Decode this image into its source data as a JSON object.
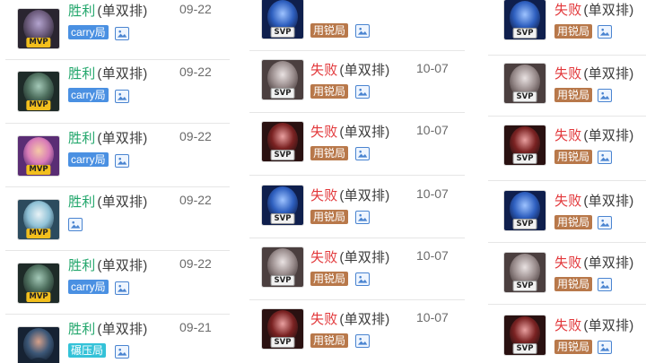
{
  "left_column": [
    {
      "result": "胜利",
      "queue": "(单双排)",
      "date": "09-22",
      "badge": "MVP",
      "tag": "carry局",
      "tag_style": "carry",
      "palette": [
        "#2a2530",
        "#6d5c7d",
        "#b3a4cf"
      ]
    },
    {
      "result": "胜利",
      "queue": "(单双排)",
      "date": "09-22",
      "badge": "MVP",
      "tag": "carry局",
      "tag_style": "carry",
      "palette": [
        "#1e2b28",
        "#4e6f5e",
        "#a4c9b8"
      ]
    },
    {
      "result": "胜利",
      "queue": "(单双排)",
      "date": "09-22",
      "badge": "MVP",
      "tag": "carry局",
      "tag_style": "carry",
      "palette": [
        "#5a2d74",
        "#d97cb8",
        "#f5c9a6"
      ]
    },
    {
      "result": "胜利",
      "queue": "(单双排)",
      "date": "09-22",
      "badge": "MVP",
      "tag": "",
      "tag_style": "",
      "palette": [
        "#2c4b5e",
        "#8fc1d6",
        "#e8f2f6"
      ]
    },
    {
      "result": "胜利",
      "queue": "(单双排)",
      "date": "09-22",
      "badge": "MVP",
      "tag": "carry局",
      "tag_style": "carry",
      "palette": [
        "#1e2b28",
        "#4e6f5e",
        "#a4c9b8"
      ]
    },
    {
      "result": "胜利",
      "queue": "(单双排)",
      "date": "09-21",
      "badge": "",
      "tag": "碾压局",
      "tag_style": "teal",
      "palette": [
        "#162233",
        "#3c5777",
        "#d6a08a"
      ]
    }
  ],
  "middle_column": [
    {
      "result": "",
      "queue": "",
      "date": "",
      "badge": "SVP",
      "tag": "用锐局",
      "tag_style": "gold",
      "palette": [
        "#0f1f4d",
        "#2e5fbf",
        "#9ec3ff"
      ]
    },
    {
      "result": "失败",
      "queue": "(单双排)",
      "date": "10-07",
      "badge": "SVP",
      "tag": "用锐局",
      "tag_style": "gold",
      "palette": [
        "#4b3f3f",
        "#9a8d8d",
        "#e9e2e2"
      ]
    },
    {
      "result": "失败",
      "queue": "(单双排)",
      "date": "10-07",
      "badge": "SVP",
      "tag": "用锐局",
      "tag_style": "gold",
      "palette": [
        "#2a1111",
        "#7a2222",
        "#e9a0a0"
      ]
    },
    {
      "result": "失败",
      "queue": "(单双排)",
      "date": "10-07",
      "badge": "SVP",
      "tag": "用锐局",
      "tag_style": "gold",
      "palette": [
        "#0f1f4d",
        "#2e5fbf",
        "#9ec3ff"
      ]
    },
    {
      "result": "失败",
      "queue": "(单双排)",
      "date": "10-07",
      "badge": "SVP",
      "tag": "用锐局",
      "tag_style": "gold",
      "palette": [
        "#4b3f3f",
        "#9a8d8d",
        "#e9e2e2"
      ]
    },
    {
      "result": "失败",
      "queue": "(单双排)",
      "date": "10-07",
      "badge": "SVP",
      "tag": "用锐局",
      "tag_style": "gold",
      "palette": [
        "#2a1111",
        "#7a2222",
        "#e9a0a0"
      ]
    }
  ],
  "right_column": [
    {
      "result": "失败",
      "queue": "(单双排)",
      "date": "",
      "badge": "SVP",
      "tag": "用锐局",
      "tag_style": "gold",
      "palette": [
        "#0f1f4d",
        "#2e5fbf",
        "#9ec3ff"
      ]
    },
    {
      "result": "失败",
      "queue": "(单双排)",
      "date": "",
      "badge": "SVP",
      "tag": "用锐局",
      "tag_style": "gold",
      "palette": [
        "#4b3f3f",
        "#9a8d8d",
        "#e9e2e2"
      ]
    },
    {
      "result": "失败",
      "queue": "(单双排)",
      "date": "",
      "badge": "SVP",
      "tag": "用锐局",
      "tag_style": "gold",
      "palette": [
        "#2a1111",
        "#7a2222",
        "#e9a0a0"
      ]
    },
    {
      "result": "失败",
      "queue": "(单双排)",
      "date": "",
      "badge": "SVP",
      "tag": "用锐局",
      "tag_style": "gold",
      "palette": [
        "#0f1f4d",
        "#2e5fbf",
        "#9ec3ff"
      ]
    },
    {
      "result": "失败",
      "queue": "(单双排)",
      "date": "",
      "badge": "SVP",
      "tag": "用锐局",
      "tag_style": "gold",
      "palette": [
        "#4b3f3f",
        "#9a8d8d",
        "#e9e2e2"
      ]
    },
    {
      "result": "失败",
      "queue": "(单双排)",
      "date": "",
      "badge": "SVP",
      "tag": "用锐局",
      "tag_style": "gold",
      "palette": [
        "#2a1111",
        "#7a2222",
        "#e9a0a0"
      ]
    }
  ],
  "colors": {
    "win": "#21a66b",
    "loss": "#e2373a",
    "carry_tag": "#4a90e2",
    "gold_tag": "#b8784a",
    "teal_tag": "#34c2d8",
    "mvp_badge": "#f2bf1d"
  },
  "icons": {
    "screenshot": "image-icon"
  }
}
